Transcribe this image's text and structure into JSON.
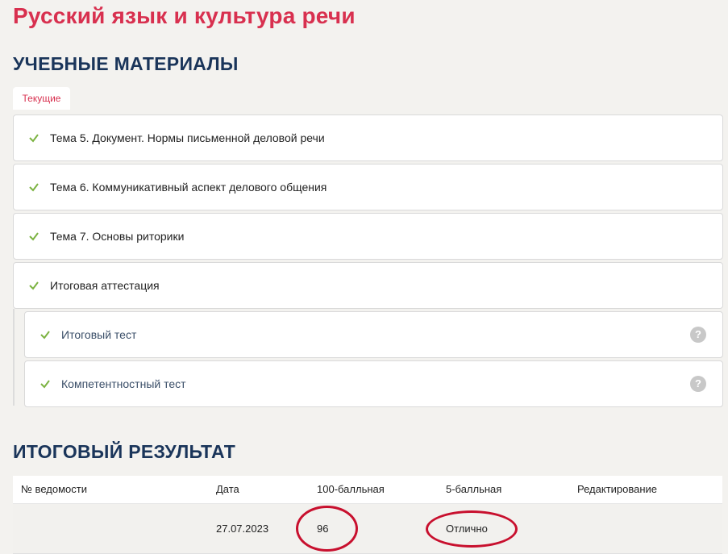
{
  "course": {
    "title": "Русский язык и культура речи"
  },
  "materials": {
    "heading": "УЧЕБНЫЕ МАТЕРИАЛЫ",
    "tab_label": "Текущие",
    "items": [
      {
        "label": "Тема 5. Документ. Нормы письменной деловой речи"
      },
      {
        "label": "Тема 6. Коммуникативный аспект делового общения"
      },
      {
        "label": "Тема 7. Основы риторики"
      },
      {
        "label": "Итоговая аттестация"
      }
    ],
    "sub_items": [
      {
        "label": "Итоговый тест",
        "help": "?"
      },
      {
        "label": "Компетентностный тест",
        "help": "?"
      }
    ]
  },
  "result": {
    "heading": "ИТОГОВЫЙ РЕЗУЛЬТАТ",
    "columns": [
      "№ ведомости",
      "Дата",
      "100-балльная",
      "5-балльная",
      "Редактирование"
    ],
    "rows": [
      {
        "statement": "",
        "date": "27.07.2023",
        "score100": "96",
        "score5": "Отлично",
        "edit": ""
      }
    ]
  },
  "colors": {
    "accent": "#d8304f",
    "heading": "#1a355a",
    "check": "#7cb342",
    "annotation": "#c8102e"
  }
}
